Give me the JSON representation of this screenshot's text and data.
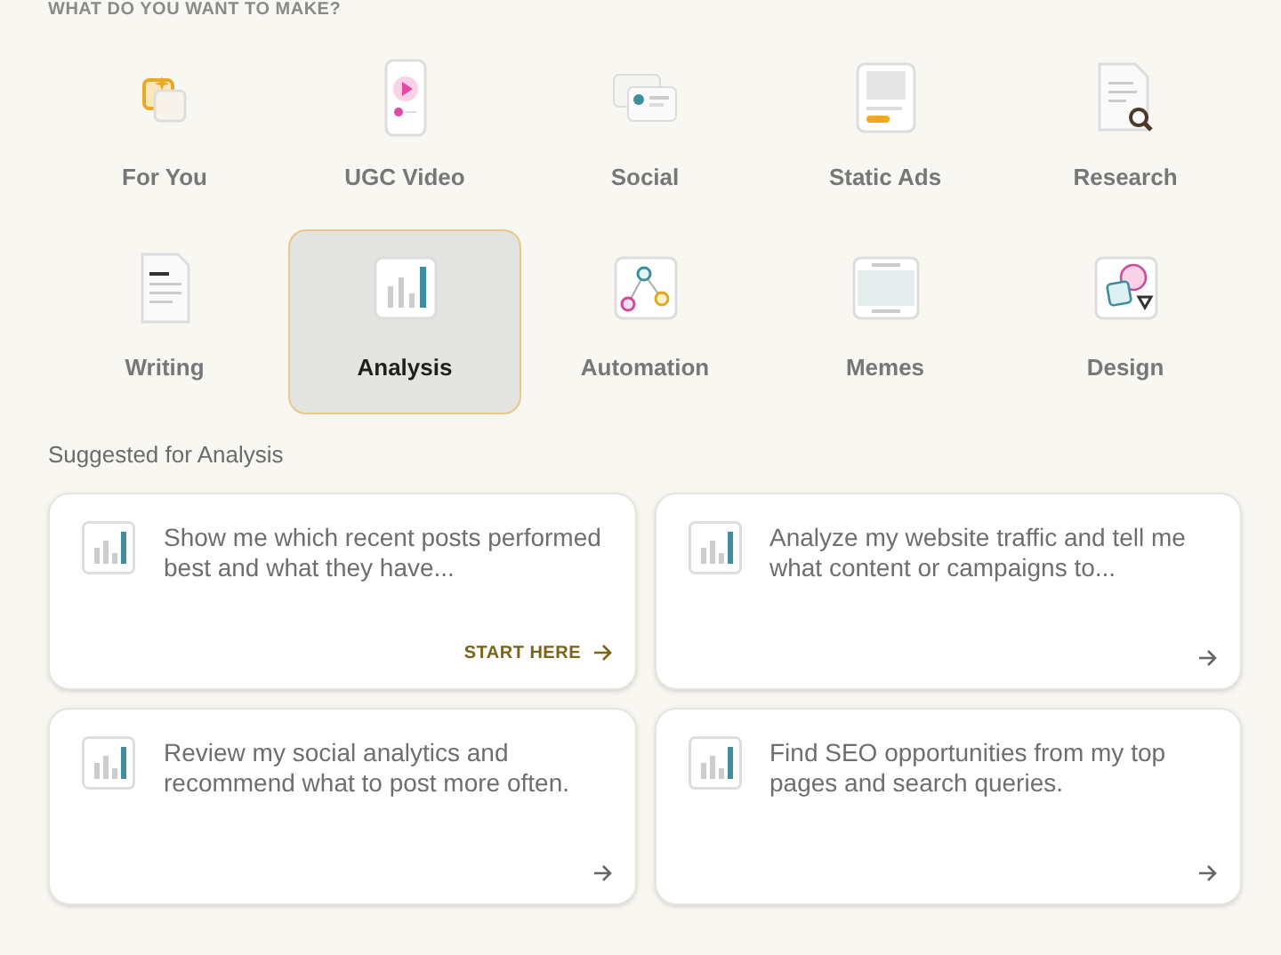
{
  "heading": "WHAT DO YOU WANT TO MAKE?",
  "categories": [
    {
      "kind": "foryou",
      "label": "For You",
      "selected": false
    },
    {
      "kind": "video",
      "label": "UGC Video",
      "selected": false
    },
    {
      "kind": "social",
      "label": "Social",
      "selected": false
    },
    {
      "kind": "ads",
      "label": "Static Ads",
      "selected": false
    },
    {
      "kind": "research",
      "label": "Research",
      "selected": false
    },
    {
      "kind": "writing",
      "label": "Writing",
      "selected": false
    },
    {
      "kind": "analysis",
      "label": "Analysis",
      "selected": true
    },
    {
      "kind": "automation",
      "label": "Automation",
      "selected": false
    },
    {
      "kind": "memes",
      "label": "Memes",
      "selected": false
    },
    {
      "kind": "design",
      "label": "Design",
      "selected": false
    }
  ],
  "suggested_title": "Suggested for Analysis",
  "suggestions": [
    {
      "text": "Show me which recent posts performed best and what they have...",
      "action": "START HERE"
    },
    {
      "text": "Analyze my website traffic and tell me what content or campaigns to..."
    },
    {
      "text": "Review my social analytics and recommend what to post more often."
    },
    {
      "text": "Find SEO opportunities from my top pages and search queries."
    }
  ]
}
